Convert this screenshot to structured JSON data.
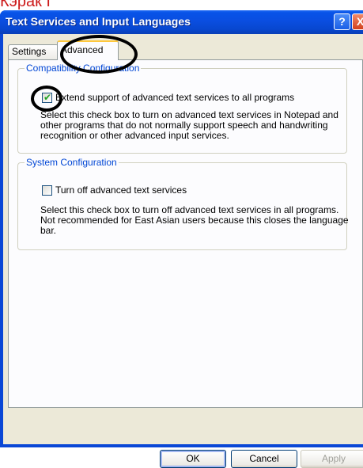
{
  "overlay": {
    "text": "Кэрак I"
  },
  "window": {
    "title": "Text Services and Input Languages",
    "help_glyph": "?",
    "close_glyph": "X"
  },
  "tabs": [
    {
      "label": "Settings"
    },
    {
      "label": "Advanced",
      "selected": true
    }
  ],
  "compatibility": {
    "legend": "Compatibility Configuration",
    "checkbox_label": "Extend support of advanced text services to all programs",
    "checked": true,
    "description": "Select this check box to turn on advanced text services in Notepad and other programs that do not normally support speech and handwriting recognition or other advanced input services."
  },
  "system": {
    "legend": "System Configuration",
    "checkbox_label": "Turn off advanced text services",
    "checked": false,
    "description": "Select this check box to turn off advanced text services in all programs. Not recommended for East Asian users because this closes the language bar."
  },
  "buttons": {
    "ok": "OK",
    "cancel": "Cancel",
    "apply": "Apply"
  },
  "colors": {
    "titlebar": "#0a4ee0",
    "overlay_text": "#cc1a1a",
    "legend_text": "#0046d5",
    "annotation_circle": "#000000"
  }
}
